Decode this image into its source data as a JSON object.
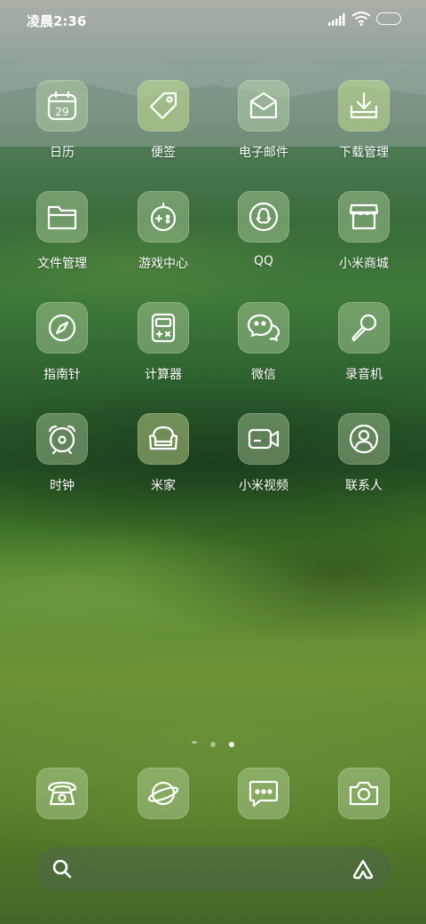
{
  "status_bar": {
    "time": "凌晨2:36"
  },
  "apps": [
    {
      "label": "日历",
      "icon": "calendar-icon",
      "day": "29"
    },
    {
      "label": "便签",
      "icon": "tag-icon"
    },
    {
      "label": "电子邮件",
      "icon": "email-icon"
    },
    {
      "label": "下载管理",
      "icon": "download-icon"
    },
    {
      "label": "文件管理",
      "icon": "folder-icon"
    },
    {
      "label": "游戏中心",
      "icon": "gamepad-icon"
    },
    {
      "label": "QQ",
      "icon": "qq-penguin-icon"
    },
    {
      "label": "小米商城",
      "icon": "shop-icon"
    },
    {
      "label": "指南针",
      "icon": "compass-icon"
    },
    {
      "label": "计算器",
      "icon": "calculator-icon"
    },
    {
      "label": "微信",
      "icon": "wechat-icon"
    },
    {
      "label": "录音机",
      "icon": "microphone-icon"
    },
    {
      "label": "时钟",
      "icon": "alarm-clock-icon"
    },
    {
      "label": "米家",
      "icon": "armchair-icon"
    },
    {
      "label": "小米视频",
      "icon": "video-camera-icon"
    },
    {
      "label": "联系人",
      "icon": "contact-icon"
    }
  ],
  "page_indicator": {
    "pages": 3,
    "current": 3
  },
  "dock": [
    {
      "icon": "phone-icon"
    },
    {
      "icon": "browser-planet-icon"
    },
    {
      "icon": "message-icon"
    },
    {
      "icon": "camera-icon"
    }
  ],
  "search_bar": {
    "left_icon": "search-icon",
    "right_icon": "assistant-icon"
  }
}
